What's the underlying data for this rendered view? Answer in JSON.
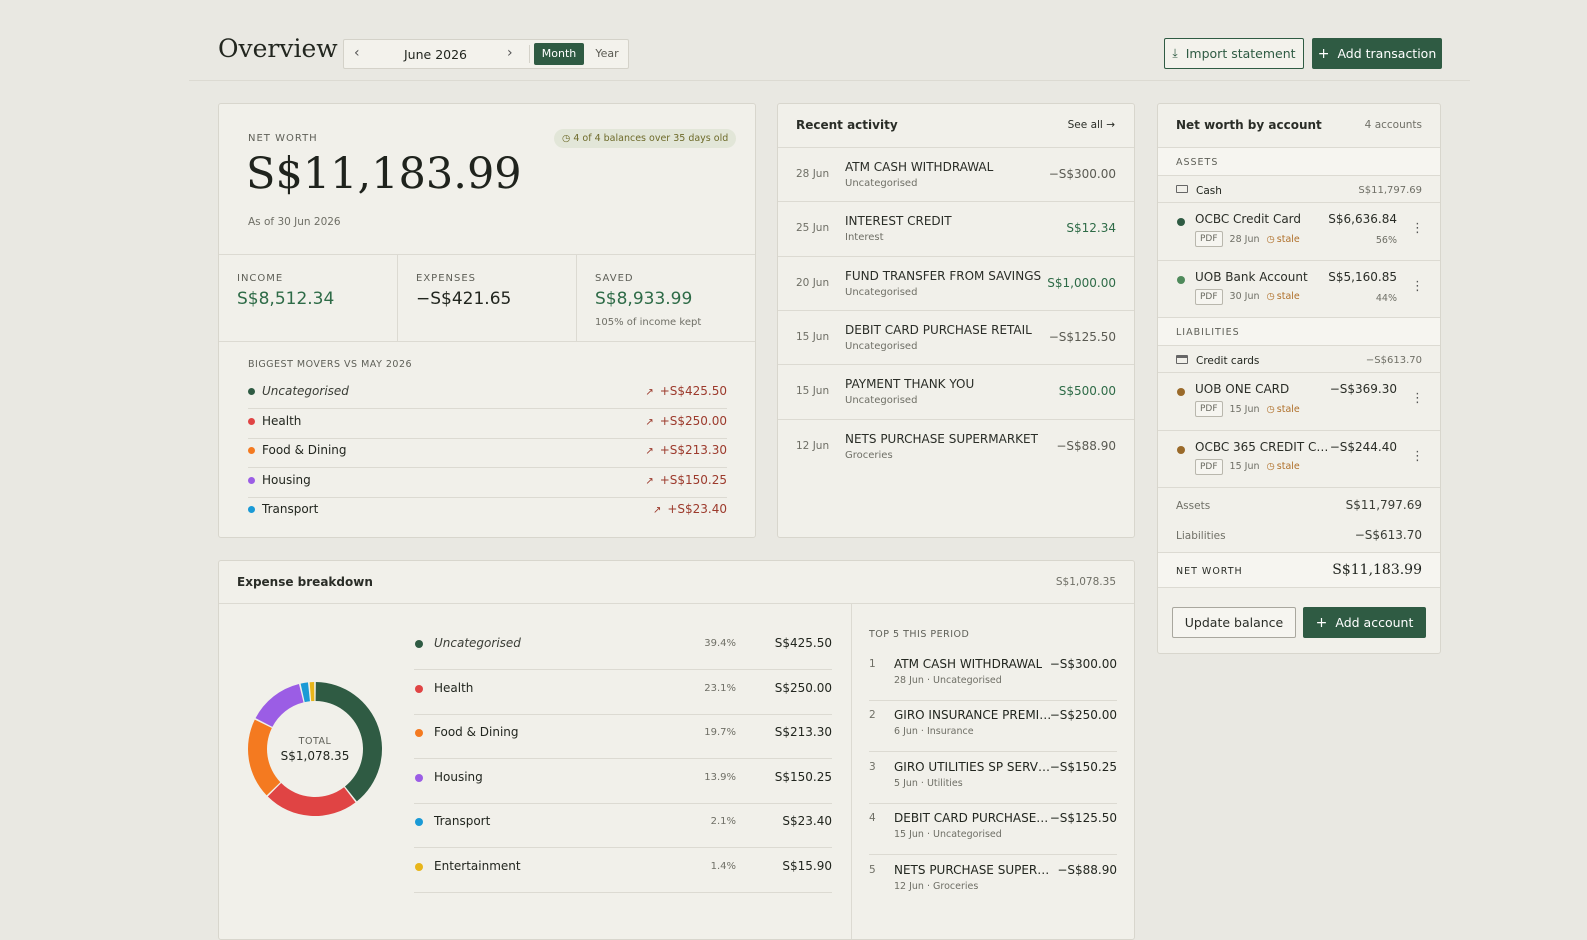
{
  "header": {
    "title": "Overview",
    "period": "June 2026",
    "toggle": {
      "month": "Month",
      "year": "Year"
    },
    "import_label": "Import statement",
    "add_label": "Add transaction"
  },
  "networth": {
    "label": "NET WORTH",
    "value": "S$11,183.99",
    "as_of": "As of 30 Jun 2026",
    "stale_badge": "4 of 4 balances over 35 days old",
    "income_label": "INCOME",
    "income": "S$8,512.34",
    "expenses_label": "EXPENSES",
    "expenses": "−S$421.65",
    "saved_label": "SAVED",
    "saved": "S$8,933.99",
    "saved_note": "105% of income kept"
  },
  "movers": {
    "title": "BIGGEST MOVERS VS MAY 2026",
    "items": [
      {
        "name": "Uncategorised",
        "amount": "+S$425.50",
        "color": "#2f5b43"
      },
      {
        "name": "Health",
        "amount": "+S$250.00",
        "color": "#e04444"
      },
      {
        "name": "Food & Dining",
        "amount": "+S$213.30",
        "color": "#f47a20"
      },
      {
        "name": "Housing",
        "amount": "+S$150.25",
        "color": "#9b5de5"
      },
      {
        "name": "Transport",
        "amount": "+S$23.40",
        "color": "#1a9ad6"
      }
    ]
  },
  "activity": {
    "title": "Recent activity",
    "see_all": "See all",
    "items": [
      {
        "date": "28 Jun",
        "name": "ATM CASH WITHDRAWAL",
        "category": "Uncategorised",
        "amount": "−S$300.00",
        "positive": false
      },
      {
        "date": "25 Jun",
        "name": "INTEREST CREDIT",
        "category": "Interest",
        "amount": "S$12.34",
        "positive": true
      },
      {
        "date": "20 Jun",
        "name": "FUND TRANSFER FROM SAVINGS",
        "category": "Uncategorised",
        "amount": "S$1,000.00",
        "positive": true
      },
      {
        "date": "15 Jun",
        "name": "DEBIT CARD PURCHASE RETAIL",
        "category": "Uncategorised",
        "amount": "−S$125.50",
        "positive": false
      },
      {
        "date": "15 Jun",
        "name": "PAYMENT THANK YOU",
        "category": "Uncategorised",
        "amount": "S$500.00",
        "positive": true
      },
      {
        "date": "12 Jun",
        "name": "NETS PURCHASE SUPERMARKET",
        "category": "Groceries",
        "amount": "−S$88.90",
        "positive": false
      }
    ]
  },
  "accounts": {
    "title": "Net worth by account",
    "count": "4 accounts",
    "assets_label": "ASSETS",
    "cash_group": {
      "name": "Cash",
      "total": "S$11,797.69"
    },
    "assets": [
      {
        "name": "OCBC Credit Card",
        "amount": "S$6,636.84",
        "pdf": "PDF",
        "date": "28 Jun",
        "stale": "stale",
        "share": "56%",
        "color": "#2f5b43"
      },
      {
        "name": "UOB Bank Account",
        "amount": "S$5,160.85",
        "pdf": "PDF",
        "date": "30 Jun",
        "stale": "stale",
        "share": "44%",
        "color": "#4f8a5b"
      }
    ],
    "liabilities_label": "LIABILITIES",
    "card_group": {
      "name": "Credit cards",
      "total": "−S$613.70"
    },
    "liabilities": [
      {
        "name": "UOB ONE CARD",
        "amount": "−S$369.30",
        "pdf": "PDF",
        "date": "15 Jun",
        "stale": "stale",
        "color": "#9a6a2a"
      },
      {
        "name": "OCBC 365 CREDIT CA...",
        "amount": "−S$244.40",
        "pdf": "PDF",
        "date": "15 Jun",
        "stale": "stale",
        "color": "#9a6a2a"
      }
    ],
    "summary": {
      "assets_label": "Assets",
      "assets": "S$11,797.69",
      "liabilities_label": "Liabilities",
      "liabilities": "−S$613.70",
      "networth_label": "NET WORTH",
      "networth": "S$11,183.99"
    },
    "update_label": "Update balance",
    "add_label": "Add account"
  },
  "breakdown": {
    "title": "Expense breakdown",
    "total": "S$1,078.35",
    "donut_label": "TOTAL",
    "donut_value": "S$1,078.35",
    "categories": [
      {
        "name": "Uncategorised",
        "pct": "39.4%",
        "amount": "S$425.50",
        "value": 425.5,
        "color": "#2f5b43"
      },
      {
        "name": "Health",
        "pct": "23.1%",
        "amount": "S$250.00",
        "value": 250.0,
        "color": "#e04444"
      },
      {
        "name": "Food & Dining",
        "pct": "19.7%",
        "amount": "S$213.30",
        "value": 213.3,
        "color": "#f47a20"
      },
      {
        "name": "Housing",
        "pct": "13.9%",
        "amount": "S$150.25",
        "value": 150.25,
        "color": "#9b5de5"
      },
      {
        "name": "Transport",
        "pct": "2.1%",
        "amount": "S$23.40",
        "value": 23.4,
        "color": "#1a9ad6"
      },
      {
        "name": "Entertainment",
        "pct": "1.4%",
        "amount": "S$15.90",
        "value": 15.9,
        "color": "#e8b51a"
      }
    ],
    "top_title": "TOP 5 THIS PERIOD",
    "top": [
      {
        "rank": "1",
        "name": "ATM CASH WITHDRAWAL",
        "meta": "28 Jun · Uncategorised",
        "amount": "−S$300.00"
      },
      {
        "rank": "2",
        "name": "GIRO INSURANCE PREMIU...",
        "meta": "6 Jun · Insurance",
        "amount": "−S$250.00"
      },
      {
        "rank": "3",
        "name": "GIRO UTILITIES SP SERVI...",
        "meta": "5 Jun · Utilities",
        "amount": "−S$150.25"
      },
      {
        "rank": "4",
        "name": "DEBIT CARD PURCHASE R...",
        "meta": "15 Jun · Uncategorised",
        "amount": "−S$125.50"
      },
      {
        "rank": "5",
        "name": "NETS PURCHASE SUPERM...",
        "meta": "12 Jun · Groceries",
        "amount": "−S$88.90"
      }
    ]
  }
}
